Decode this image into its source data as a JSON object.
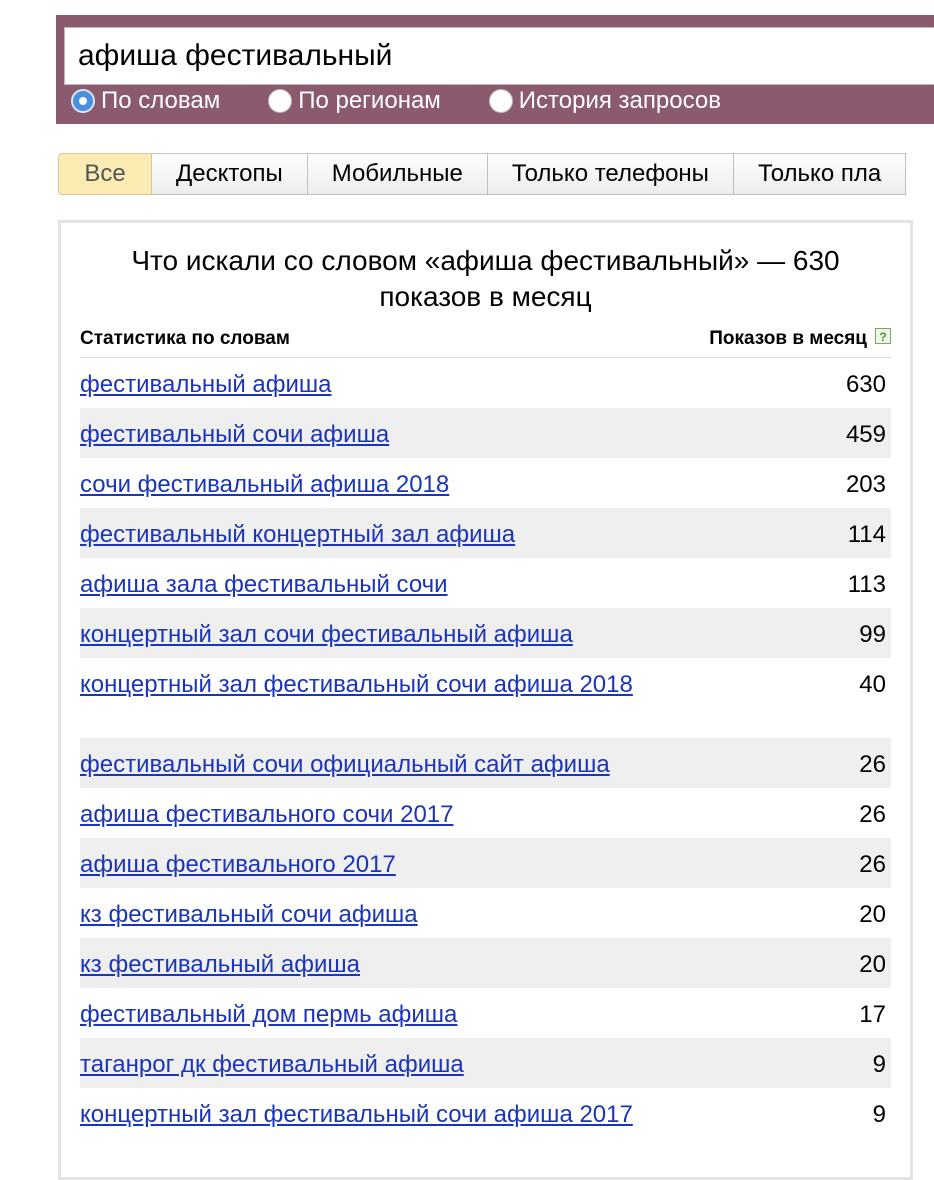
{
  "search": {
    "query": "афиша фестивальный",
    "modes": [
      {
        "label": "По словам",
        "checked": true
      },
      {
        "label": "По регионам",
        "checked": false
      },
      {
        "label": "История запросов",
        "checked": false
      }
    ]
  },
  "tabs": [
    {
      "label": "Все",
      "active": true
    },
    {
      "label": "Десктопы",
      "active": false
    },
    {
      "label": "Мобильные",
      "active": false
    },
    {
      "label": "Только телефоны",
      "active": false
    },
    {
      "label": "Только пла",
      "active": false
    }
  ],
  "panel": {
    "heading_line1": "Что искали со словом «афиша фестивальный» — 630",
    "heading_line2": "показов в месяц",
    "col_left": "Статистика по словам",
    "col_right": "Показов в месяц",
    "help": "?",
    "rows": [
      {
        "phrase": "фестивальный афиша",
        "count": "630"
      },
      {
        "phrase": "фестивальный сочи афиша",
        "count": "459"
      },
      {
        "phrase": "сочи фестивальный афиша 2018",
        "count": "203"
      },
      {
        "phrase": "фестивальный концертный зал афиша",
        "count": "114"
      },
      {
        "phrase": "афиша зала фестивальный сочи",
        "count": "113"
      },
      {
        "phrase": "концертный зал сочи фестивальный афиша",
        "count": "99"
      },
      {
        "phrase": "концертный зал фестивальный сочи афиша 2018",
        "count": "40"
      },
      {
        "phrase": "фестивальный сочи официальный сайт афиша",
        "count": "26"
      },
      {
        "phrase": "афиша фестивального сочи 2017",
        "count": "26"
      },
      {
        "phrase": "афиша фестивального 2017",
        "count": "26"
      },
      {
        "phrase": "кз фестивальный сочи афиша",
        "count": "20"
      },
      {
        "phrase": "кз фестивальный афиша",
        "count": "20"
      },
      {
        "phrase": "фестивальный дом пермь афиша",
        "count": "17"
      },
      {
        "phrase": "таганрог дк фестивальный афиша",
        "count": "9"
      },
      {
        "phrase": "концертный зал фестивальный сочи афиша 2017",
        "count": "9"
      }
    ]
  }
}
